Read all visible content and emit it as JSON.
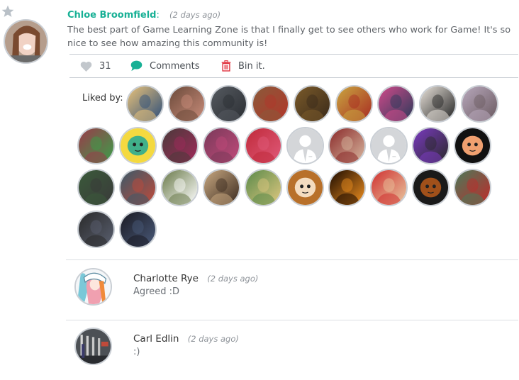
{
  "post": {
    "favorite_icon": "star-icon",
    "author": "Chloe Broomfield",
    "author_suffix": ":",
    "timestamp": "(2 days ago)",
    "body": "The best part of Game Learning Zone is that I finally get to see others who work for Game! It's so nice to see how amazing this community is!",
    "actions": {
      "likes_count": "31",
      "like_icon": "heart-icon",
      "comments_label": "Comments",
      "comments_icon": "speech-bubble-icon",
      "bin_label": "Bin it.",
      "bin_icon": "trash-icon"
    },
    "liked_by_label": "Liked by:",
    "likers": [
      {
        "kind": "photo",
        "colors": [
          "#e9c27a",
          "#2b4d7a"
        ]
      },
      {
        "kind": "photo",
        "colors": [
          "#6b4a3a",
          "#c98c7a"
        ]
      },
      {
        "kind": "photo",
        "colors": [
          "#555a60",
          "#2b2e33"
        ]
      },
      {
        "kind": "photo",
        "colors": [
          "#8a5a3a",
          "#b2362a"
        ]
      },
      {
        "kind": "photo",
        "colors": [
          "#7a5a2a",
          "#3a2a1a"
        ]
      },
      {
        "kind": "photo",
        "colors": [
          "#c9a640",
          "#a82a22"
        ]
      },
      {
        "kind": "photo",
        "colors": [
          "#d04a8a",
          "#2a3a5a"
        ]
      },
      {
        "kind": "photo",
        "colors": [
          "#e8e2da",
          "#222222"
        ]
      },
      {
        "kind": "photo",
        "colors": [
          "#b8a8bc",
          "#6a5a60"
        ]
      },
      {
        "kind": "photo",
        "colors": [
          "#9a3a4a",
          "#3aa04a"
        ]
      },
      {
        "kind": "cartoon",
        "colors": [
          "#f4d940",
          "#40b08a"
        ]
      },
      {
        "kind": "photo",
        "colors": [
          "#4a3a3a",
          "#a02a5a"
        ]
      },
      {
        "kind": "photo",
        "colors": [
          "#7a3a5a",
          "#c04a7a"
        ]
      },
      {
        "kind": "photo",
        "colors": [
          "#c02a3a",
          "#e05a7a"
        ]
      },
      {
        "kind": "placeholder",
        "colors": [
          "#d4d6d9",
          "#ffffff"
        ]
      },
      {
        "kind": "photo",
        "colors": [
          "#8a2a2a",
          "#d8b8a0"
        ]
      },
      {
        "kind": "placeholder",
        "colors": [
          "#d4d6d9",
          "#ffffff"
        ]
      },
      {
        "kind": "photo",
        "colors": [
          "#7a3ac0",
          "#2a2a2a"
        ]
      },
      {
        "kind": "cartoon",
        "colors": [
          "#111111",
          "#f0a070"
        ]
      },
      {
        "kind": "photo",
        "colors": [
          "#3a5a3a",
          "#3a3a3a"
        ]
      },
      {
        "kind": "photo",
        "colors": [
          "#3a5a6a",
          "#c04a3a"
        ]
      },
      {
        "kind": "photo",
        "colors": [
          "#6a7a4a",
          "#ffffff"
        ]
      },
      {
        "kind": "photo",
        "colors": [
          "#c8a880",
          "#3a2a20"
        ]
      },
      {
        "kind": "photo",
        "colors": [
          "#5a8a4a",
          "#e0c880"
        ]
      },
      {
        "kind": "cartoon",
        "colors": [
          "#b8702a",
          "#f4dcc0"
        ]
      },
      {
        "kind": "photo",
        "colors": [
          "#1a0a00",
          "#f09020"
        ]
      },
      {
        "kind": "photo",
        "colors": [
          "#d03030",
          "#e8c8a0"
        ]
      },
      {
        "kind": "cartoon",
        "colors": [
          "#1a1a1a",
          "#a0501a"
        ]
      },
      {
        "kind": "photo",
        "colors": [
          "#4a7a5a",
          "#c02a2a"
        ]
      },
      {
        "kind": "photo",
        "colors": [
          "#2a2a2a",
          "#5a6070"
        ]
      },
      {
        "kind": "photo",
        "colors": [
          "#1a1a22",
          "#4a5a7a"
        ]
      }
    ]
  },
  "comments": [
    {
      "author": "Charlotte Rye",
      "timestamp": "(2 days ago)",
      "text": "Agreed :D",
      "avatar_colors": [
        "#7ac8d8",
        "#f0a0b0"
      ]
    },
    {
      "author": "Carl Edlin",
      "timestamp": "(2 days ago)",
      "text": ":)",
      "avatar_colors": [
        "#555a60",
        "#2b2e33"
      ]
    }
  ],
  "colors": {
    "accent": "#17b095",
    "like_icon": "#c2c7cc",
    "comment_icon": "#17b095",
    "bin_icon": "#e0343f",
    "divider": "#c9ced4"
  }
}
